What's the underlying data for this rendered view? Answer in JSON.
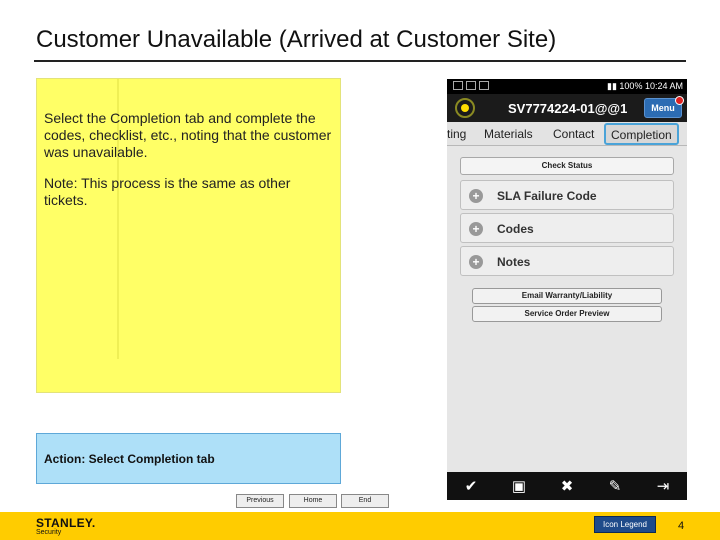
{
  "slide": {
    "title": "Customer Unavailable (Arrived at Customer Site)",
    "instructions": [
      "Select the Completion tab and complete the codes, checklist, etc., noting that the customer was unavailable.",
      "Note: This process is the same as other tickets."
    ],
    "action": "Action: Select Completion tab",
    "page_number": "4"
  },
  "nav": {
    "previous": "Previous",
    "home": "Home",
    "end": "End"
  },
  "footer": {
    "brand": "STANLEY.",
    "brand_sub": "Security",
    "legend_button": "Icon Legend",
    "bar_color": "#ffcc00"
  },
  "phone": {
    "status": {
      "battery": "100%",
      "time": "10:24 AM"
    },
    "header": {
      "order_id": "SV7774224-01@@1",
      "menu_label": "Menu",
      "logo_icon": "light-bulb-icon"
    },
    "tabs": [
      {
        "label": "ting"
      },
      {
        "label": "Materials"
      },
      {
        "label": "Contact"
      },
      {
        "label": "Completion",
        "active": true
      }
    ],
    "check_status_label": "Check Status",
    "sections": [
      {
        "label": "SLA Failure Code"
      },
      {
        "label": "Codes"
      },
      {
        "label": "Notes"
      }
    ],
    "buttons": [
      {
        "label": "Email Warranty/Liability"
      },
      {
        "label": "Service Order Preview"
      }
    ],
    "toolbar_icons": [
      "check-icon",
      "archive-icon",
      "tools-icon",
      "pencil-icon",
      "exit-icon"
    ],
    "accent_color": "#4aa3d8"
  }
}
